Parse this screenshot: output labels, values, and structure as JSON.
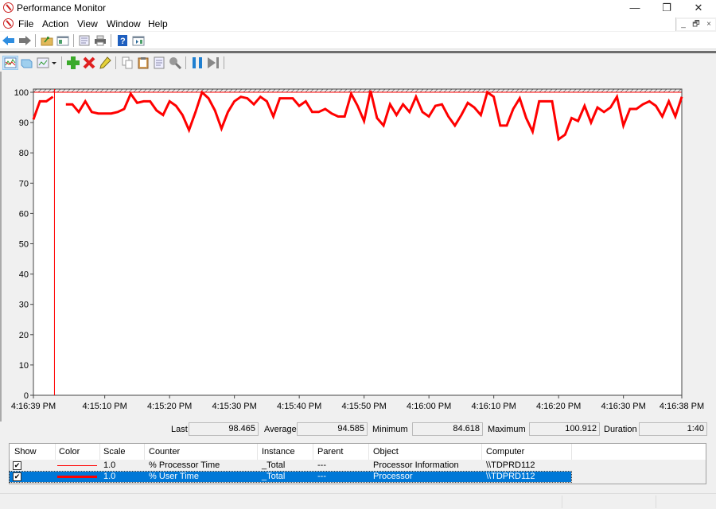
{
  "window": {
    "title": "Performance Monitor",
    "controls": {
      "minimize": "—",
      "restore": "❐",
      "close": "✕"
    }
  },
  "menubar": {
    "items": [
      {
        "label": "File",
        "accel": "F"
      },
      {
        "label": "Action",
        "accel": "A"
      },
      {
        "label": "View",
        "accel": "V"
      },
      {
        "label": "Window",
        "accel": "W"
      },
      {
        "label": "Help",
        "accel": "H"
      }
    ],
    "mdi_controls": {
      "minimize": "_",
      "restore": "🗗",
      "close": "×"
    }
  },
  "toolbar1": {
    "icons": [
      "back-arrow",
      "forward-arrow",
      "folder-up",
      "show-hide-console-tree",
      "properties",
      "print",
      "help",
      "show-hide-action-pane"
    ]
  },
  "toolbar2": {
    "icons": [
      "view-graph",
      "view-histogram",
      "change-graph-type",
      "dropdown",
      "add-counter",
      "delete-counter",
      "highlight",
      "copy-properties",
      "paste-counter-list",
      "properties",
      "zoom",
      "freeze-display",
      "update-data"
    ]
  },
  "stats": {
    "last_label": "Last",
    "last_value": "98.465",
    "average_label": "Average",
    "average_value": "94.585",
    "minimum_label": "Minimum",
    "minimum_value": "84.618",
    "maximum_label": "Maximum",
    "maximum_value": "100.912",
    "duration_label": "Duration",
    "duration_value": "1:40"
  },
  "legend": {
    "columns": [
      "Show",
      "Color",
      "Scale",
      "Counter",
      "Instance",
      "Parent",
      "Object",
      "Computer"
    ],
    "rows": [
      {
        "show": true,
        "color": "#ff0000",
        "line": "thin",
        "scale": "1.0",
        "counter": "% Processor Time",
        "instance": "_Total",
        "parent": "---",
        "object": "Processor Information",
        "computer": "\\\\TDPRD112",
        "selected": false
      },
      {
        "show": true,
        "color": "#ff0000",
        "line": "thick",
        "scale": "1.0",
        "counter": "% User Time",
        "instance": "_Total",
        "parent": "---",
        "object": "Processor",
        "computer": "\\\\TDPRD112",
        "selected": true
      }
    ]
  },
  "colors": {
    "series": "#ff0000",
    "selection": "#0078d7"
  },
  "chart_data": {
    "type": "line",
    "title": "",
    "xlabel": "",
    "ylabel": "",
    "ylim": [
      0,
      100
    ],
    "yticks": [
      0,
      10,
      20,
      30,
      40,
      50,
      60,
      70,
      80,
      90,
      100
    ],
    "xtick_labels": [
      "4:16:39 PM",
      "4:15:10 PM",
      "4:15:20 PM",
      "4:15:30 PM",
      "4:15:40 PM",
      "4:15:50 PM",
      "4:16:00 PM",
      "4:16:10 PM",
      "4:16:20 PM",
      "4:16:30 PM",
      "4:16:38 PM"
    ],
    "xtick_positions": [
      0,
      11,
      21,
      31,
      41,
      51,
      61,
      71,
      81,
      91,
      100
    ],
    "grid": false,
    "samples": 101,
    "cursor_index": 3,
    "series": [
      {
        "name": "% User Time",
        "color": "#ff0000",
        "values": [
          91,
          97,
          97,
          98.5,
          null,
          96,
          96,
          93.5,
          97,
          93.5,
          93,
          93,
          93,
          93.5,
          94.5,
          99.5,
          96.5,
          97,
          97,
          94,
          92.5,
          97,
          95.5,
          92.5,
          87.5,
          93.5,
          100,
          98,
          94,
          88,
          93.5,
          97,
          98.5,
          98,
          96,
          98.5,
          97,
          92,
          98,
          98,
          98,
          95.5,
          97,
          93.5,
          93.5,
          94.5,
          93,
          92,
          92,
          99.5,
          95.5,
          90.5,
          101,
          91.5,
          89,
          96,
          92.5,
          96,
          93.5,
          98.5,
          93.5,
          92,
          95.5,
          96,
          92,
          89,
          92.5,
          96.5,
          95,
          92.5,
          100,
          98.5,
          89,
          89,
          94.5,
          98,
          91.5,
          87,
          97,
          97,
          97,
          84.5,
          86,
          91.5,
          90.5,
          95.5,
          90,
          95,
          93.5,
          95,
          98.5,
          89,
          94.5,
          94.5,
          96,
          97,
          95.5,
          92,
          97,
          92,
          98.5
        ]
      }
    ]
  }
}
